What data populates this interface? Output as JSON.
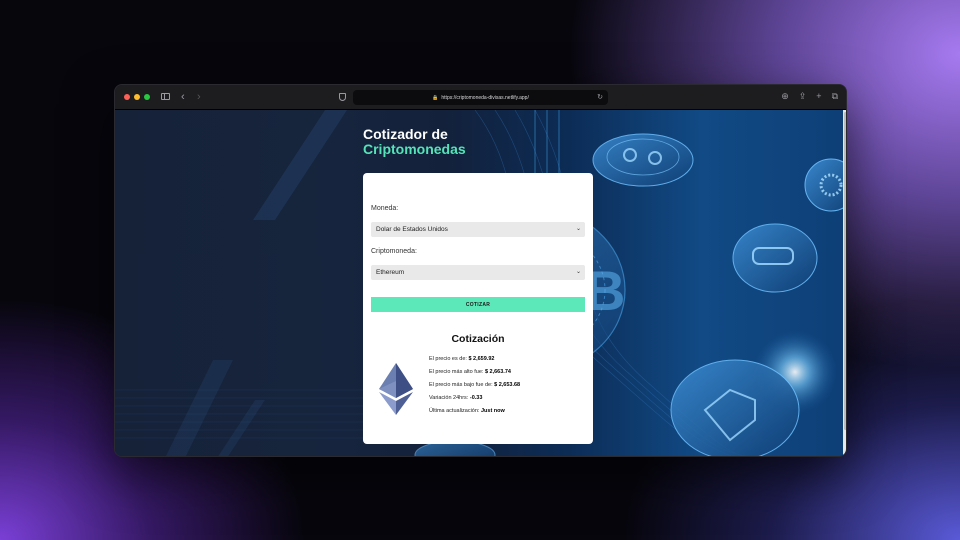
{
  "browser": {
    "url": "https://criptomoneda-divisas.netlify.app/",
    "secure_icon": "lock-icon"
  },
  "page": {
    "heading_line1": "Cotizador de",
    "heading_line2": "Criptomonedas",
    "colors": {
      "accent": "#5de8b9",
      "heading_accent": "#55e4b8",
      "card": "#ffffff"
    }
  },
  "form": {
    "currency_label": "Moneda:",
    "currency_value": "Dolar de Estados Unidos",
    "crypto_label": "Criptomoneda:",
    "crypto_value": "Ethereum",
    "submit_label": "COTIZAR"
  },
  "result": {
    "title": "Cotización",
    "icon": "ethereum-logo",
    "price_label": "El precio es de:",
    "price_value": "$ 2,659.92",
    "high_label": "El precio más alto fue:",
    "high_value": "$ 2,663.74",
    "low_label": "El precio más bajo fue de:",
    "low_value": "$ 2,653.68",
    "change_label": "Variación 24hrs:",
    "change_value": "-0.33",
    "updated_label": "Última actualización:",
    "updated_value": "Just now"
  }
}
